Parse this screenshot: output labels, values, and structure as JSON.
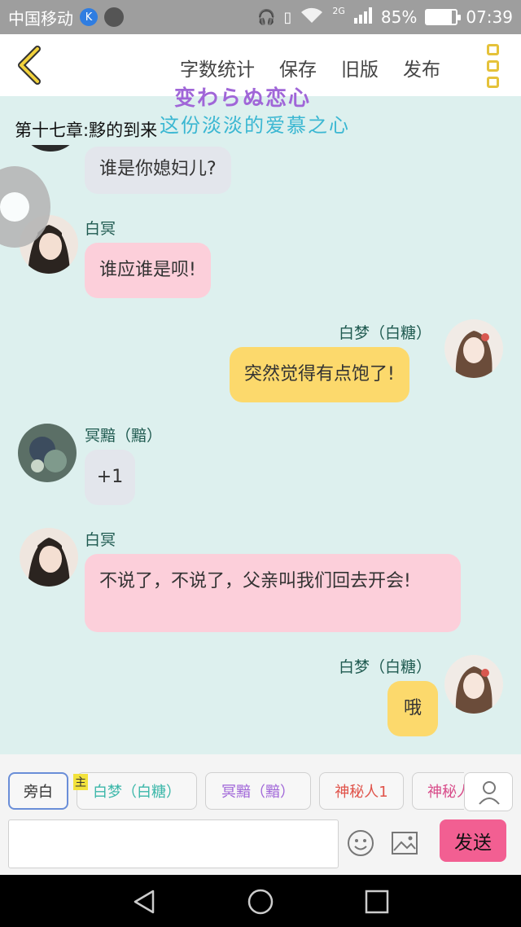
{
  "status_bar": {
    "carrier": "中国移动",
    "k_badge": "K",
    "net": "2G",
    "battery": "85%",
    "time": "07:39",
    "icons": [
      "headphones-icon",
      "vibrate-icon",
      "wifi-icon",
      "signal-icon",
      "battery-icon"
    ]
  },
  "toolbar": {
    "back_icon": "chevron-left-icon",
    "items": [
      "字数统计",
      "保存",
      "旧版",
      "发布"
    ],
    "menu_icon": "menu-dots-icon",
    "accent": "#e5c23a"
  },
  "chapter_title": "第十七章:黟的到来",
  "logo": {
    "line1": "变わらぬ恋心",
    "line2": "这份淡淡的爱慕之心"
  },
  "messages": [
    {
      "side": "left",
      "text": "谁是你媳妇儿?",
      "color": "grey"
    },
    {
      "side": "left",
      "name": "白冥",
      "text": "谁应谁是呗!",
      "color": "pink"
    },
    {
      "side": "right",
      "name": "白梦（白糖）",
      "text": "突然觉得有点饱了!",
      "color": "yellow"
    },
    {
      "side": "left",
      "name": "冥黯（黯）",
      "text": "+1",
      "color": "grey"
    },
    {
      "side": "left",
      "name": "白冥",
      "text": "不说了，不说了，父亲叫我们回去开会!",
      "color": "pink"
    },
    {
      "side": "right",
      "name": "白梦（白糖）",
      "text": "哦",
      "color": "yellow"
    }
  ],
  "roles": {
    "main_tag": "主",
    "chips": [
      "旁白",
      "白梦（白糖）",
      "冥黯（黯）",
      "神秘人1",
      "神秘人"
    ],
    "chip_colors": [
      "#333333",
      "#3bb7a9",
      "#a066d8",
      "#e0534a",
      "#d84c8a"
    ]
  },
  "input": {
    "placeholder": "",
    "send_label": "发送",
    "send_color": "#f25f92"
  },
  "nav": [
    "back-triangle-icon",
    "home-circle-icon",
    "recents-square-icon"
  ]
}
